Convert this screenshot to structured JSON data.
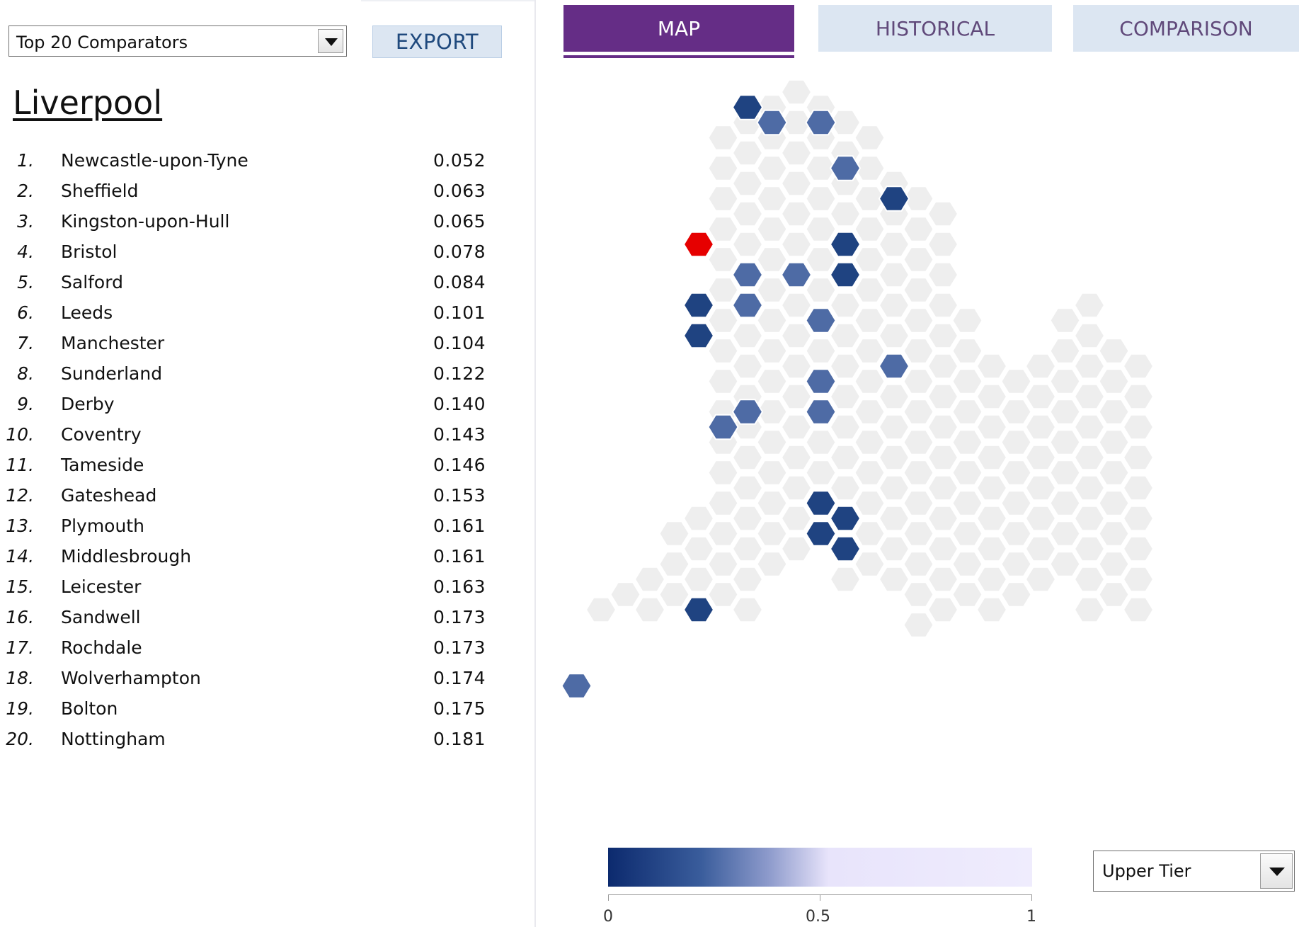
{
  "comparator_select": {
    "value": "Top 20 Comparators"
  },
  "export": {
    "label": "EXPORT"
  },
  "selected_area": "Liverpool",
  "rankings": [
    {
      "rank": "1.",
      "name": "Newcastle-upon-Tyne",
      "score": "0.052"
    },
    {
      "rank": "2.",
      "name": "Sheffield",
      "score": "0.063"
    },
    {
      "rank": "3.",
      "name": "Kingston-upon-Hull",
      "score": "0.065"
    },
    {
      "rank": "4.",
      "name": "Bristol",
      "score": "0.078"
    },
    {
      "rank": "5.",
      "name": "Salford",
      "score": "0.084"
    },
    {
      "rank": "6.",
      "name": "Leeds",
      "score": "0.101"
    },
    {
      "rank": "7.",
      "name": "Manchester",
      "score": "0.104"
    },
    {
      "rank": "8.",
      "name": "Sunderland",
      "score": "0.122"
    },
    {
      "rank": "9.",
      "name": "Derby",
      "score": "0.140"
    },
    {
      "rank": "10.",
      "name": "Coventry",
      "score": "0.143"
    },
    {
      "rank": "11.",
      "name": "Tameside",
      "score": "0.146"
    },
    {
      "rank": "12.",
      "name": "Gateshead",
      "score": "0.153"
    },
    {
      "rank": "13.",
      "name": "Plymouth",
      "score": "0.161"
    },
    {
      "rank": "14.",
      "name": "Middlesbrough",
      "score": "0.161"
    },
    {
      "rank": "15.",
      "name": "Leicester",
      "score": "0.163"
    },
    {
      "rank": "16.",
      "name": "Sandwell",
      "score": "0.173"
    },
    {
      "rank": "17.",
      "name": "Rochdale",
      "score": "0.173"
    },
    {
      "rank": "18.",
      "name": "Wolverhampton",
      "score": "0.174"
    },
    {
      "rank": "19.",
      "name": "Bolton",
      "score": "0.175"
    },
    {
      "rank": "20.",
      "name": "Nottingham",
      "score": "0.181"
    }
  ],
  "tabs": [
    {
      "label": "MAP",
      "active": true
    },
    {
      "label": "HISTORICAL",
      "active": false
    },
    {
      "label": "COMPARISON",
      "active": false
    }
  ],
  "legend": {
    "min_label": "0",
    "mid_label": "0.5",
    "max_label": "1"
  },
  "tier_select": {
    "value": "Upper Tier"
  },
  "colors": {
    "selected": "#e60000",
    "dark_blue": "#1f4381",
    "mid_blue": "#4e6ba5",
    "background_hex": "#eeeeee",
    "tab_active": "#652d86",
    "tab_inactive": "#dce6f2"
  }
}
